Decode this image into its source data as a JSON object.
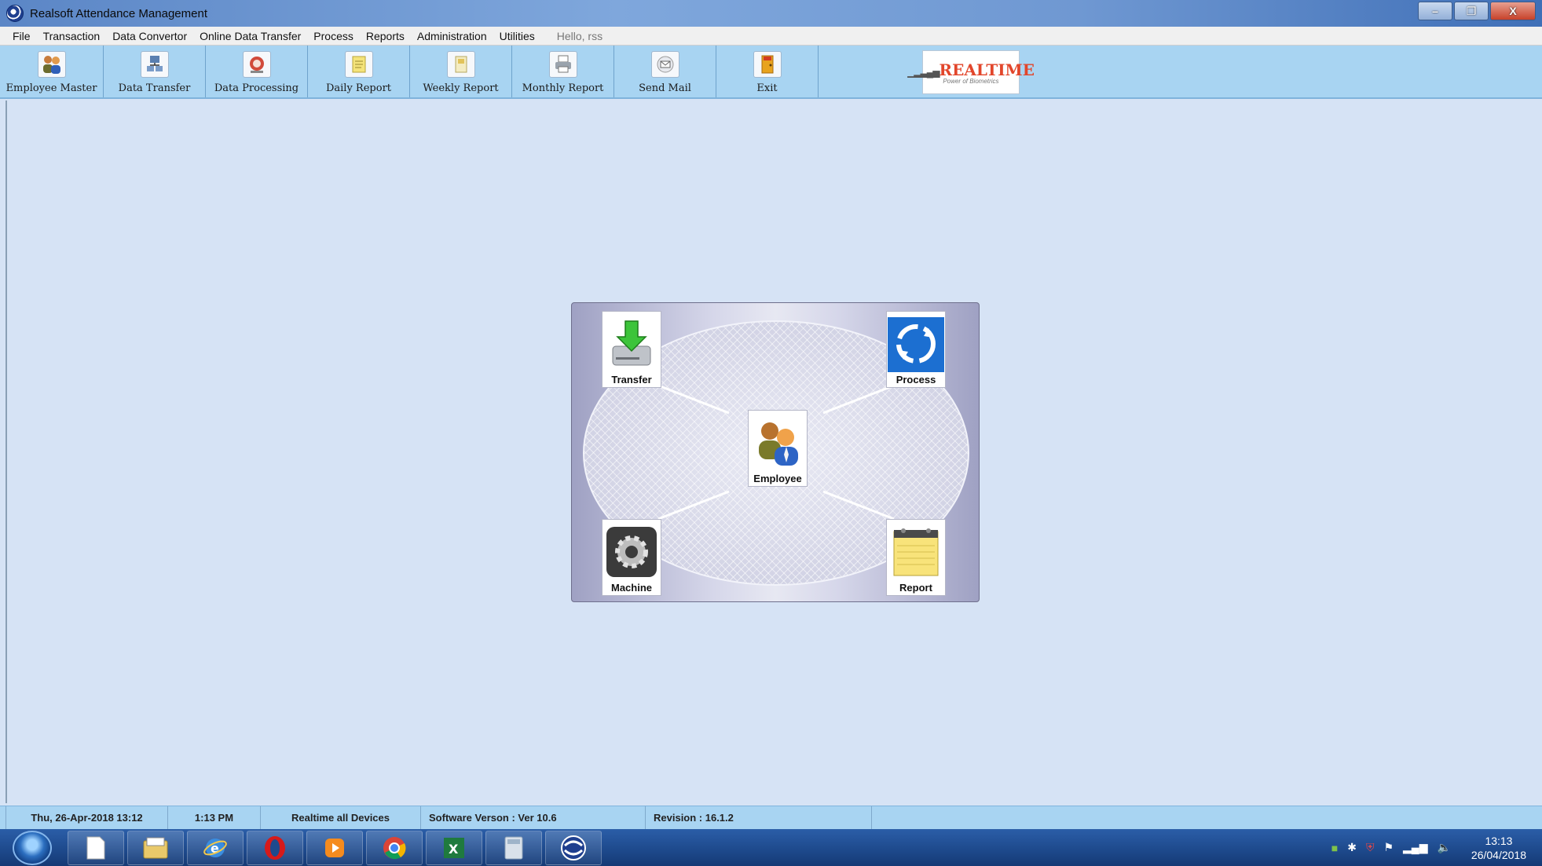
{
  "window": {
    "title": "Realsoft Attendance Management",
    "controls": [
      "–",
      "❐",
      "X"
    ]
  },
  "menu": {
    "items": [
      "File",
      "Transaction",
      "Data Convertor",
      "Online Data Transfer",
      "Process",
      "Reports",
      "Administration",
      "Utilities"
    ],
    "greeting": "Hello, rss"
  },
  "toolbar": {
    "buttons": [
      {
        "label": "Employee Master",
        "icon": "employees-icon"
      },
      {
        "label": "Data Transfer",
        "icon": "network-icon"
      },
      {
        "label": "Data Processing",
        "icon": "processing-icon"
      },
      {
        "label": "Daily Report",
        "icon": "notepad-icon"
      },
      {
        "label": "Weekly Report",
        "icon": "document-icon"
      },
      {
        "label": "Monthly Report",
        "icon": "printer-icon"
      },
      {
        "label": "Send Mail",
        "icon": "envelope-icon"
      },
      {
        "label": "Exit",
        "icon": "exit-door-icon"
      }
    ],
    "logo": {
      "text": "REALTIME",
      "tagline": "Power of Biometrics"
    }
  },
  "dashboard": {
    "nodes": {
      "transfer": "Transfer",
      "process": "Process",
      "employee": "Employee",
      "machine": "Machine",
      "report": "Report"
    }
  },
  "status": {
    "datetime": "Thu, 26-Apr-2018 13:12",
    "time": "1:13 PM",
    "devices": "Realtime all Devices",
    "version": "Software Verson : Ver 10.6",
    "revision": "Revision : 16.1.2"
  },
  "taskbar": {
    "apps": [
      "file-icon",
      "explorer-icon",
      "internet-explorer-icon",
      "opera-icon",
      "media-player-icon",
      "chrome-icon",
      "excel-icon",
      "calculator-icon",
      "realsoft-icon"
    ],
    "clock_time": "13:13",
    "clock_date": "26/04/2018"
  },
  "colors": {
    "toolbar_bg": "#a8d4f2",
    "desktop_bg": "#d6e3f5",
    "logo_red": "#e2462b"
  }
}
